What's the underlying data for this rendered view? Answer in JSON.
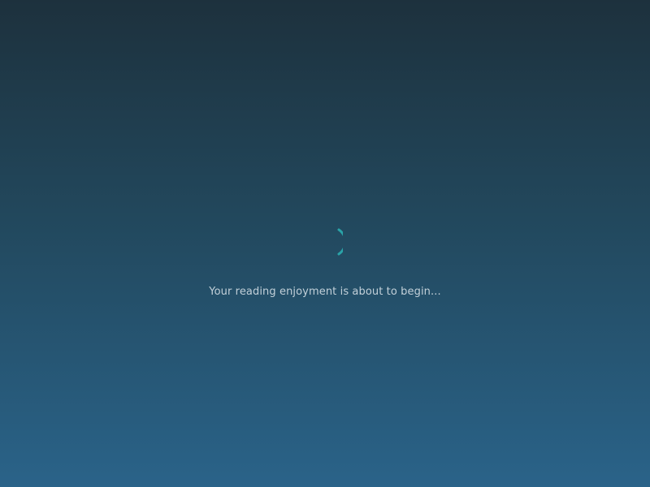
{
  "loading": {
    "message": "Your reading enjoyment is about to begin...",
    "spinner_icon": "loading-spinner-icon",
    "spinner_color": "#2aa3a8"
  },
  "colors": {
    "background_top": "#1d313d",
    "background_bottom": "#2a6389",
    "text": "#c2d0d9"
  }
}
